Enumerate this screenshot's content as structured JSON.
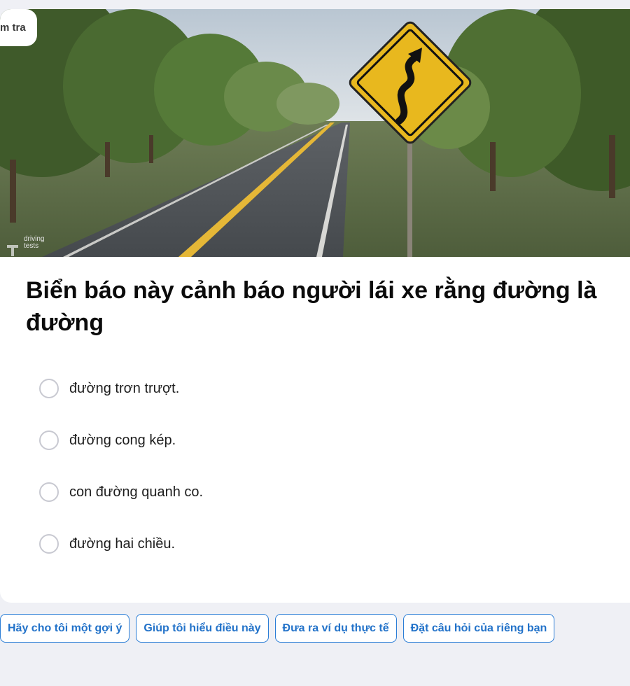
{
  "header": {
    "check_tab_label": "m tra"
  },
  "image": {
    "watermark": "driving tests",
    "sign_icon": "winding-road-sign-icon"
  },
  "question": {
    "text": "Biển báo này cảnh báo người lái xe rằng đường là đường"
  },
  "options": [
    {
      "label": "đường trơn trượt."
    },
    {
      "label": "đường cong kép."
    },
    {
      "label": "con đường quanh co."
    },
    {
      "label": "đường hai chiều."
    }
  ],
  "help_chips": [
    {
      "label": "Hãy cho tôi một gợi ý"
    },
    {
      "label": "Giúp tôi hiểu điều này"
    },
    {
      "label": "Đưa ra ví dụ thực tế"
    },
    {
      "label": "Đặt câu hỏi của riêng bạn"
    }
  ],
  "colors": {
    "page_background": "#eff0f5",
    "chip_accent": "#2272c9",
    "sign_yellow": "#e8b81e"
  }
}
